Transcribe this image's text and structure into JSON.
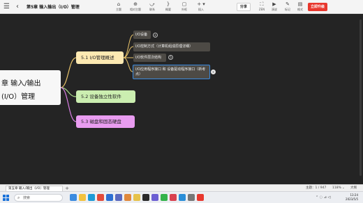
{
  "header": {
    "title": "第5章 输入输出（I/O）管理",
    "tools": [
      {
        "icon": "home-icon",
        "glyph": "⌂",
        "label": "主题"
      },
      {
        "icon": "insert-topic-icon",
        "glyph": "⊕",
        "label": "相对主题"
      },
      {
        "icon": "link-icon",
        "glyph": "⤻",
        "label": "联系"
      },
      {
        "icon": "summary-icon",
        "glyph": "}",
        "label": "概要"
      },
      {
        "icon": "frame-icon",
        "glyph": "▢",
        "label": "外框"
      },
      {
        "icon": "insert-icon",
        "glyph": "+ ▾",
        "label": "插入"
      }
    ],
    "share_label": "分享",
    "right_tools": [
      {
        "icon": "zen-mode-icon",
        "glyph": "⛶",
        "label": "ZEN"
      },
      {
        "icon": "play-icon",
        "glyph": "▶",
        "label": "演说"
      },
      {
        "icon": "marker-icon",
        "glyph": "✎",
        "label": "标记"
      },
      {
        "icon": "format-icon",
        "glyph": "▤",
        "label": "格式"
      }
    ],
    "upgrade_label": "立即升级"
  },
  "mindmap": {
    "root": {
      "line1": "章 输入/输出",
      "line2": "(I/O）管理"
    },
    "topics": [
      {
        "label": "5.1 I/O管理概述",
        "color": "#fde9b2"
      },
      {
        "label": "5.2 设备独立性软件",
        "color": "#cbeeb0"
      },
      {
        "label": "5.3 磁盘和固态硬盘",
        "color": "#e99cf0"
      }
    ],
    "subtopics": [
      {
        "label": "I/O设备",
        "toggle": "+"
      },
      {
        "label": "I/O控制方式（计算机组成原理详细）"
      },
      {
        "label": "I/O软件层次结构",
        "toggle": "5"
      },
      {
        "label": "I/O应用程序接口 和 设备驱动程序接口（新考点）",
        "toggle": "+"
      }
    ]
  },
  "sheet": {
    "tab_label": "第五章 输入/输出（I/O）管理",
    "add_label": "+",
    "topic_count": "主题：1 / 947",
    "zoom": "118%",
    "zoom_arrow": "⌄",
    "zoom_extra": "大纲"
  },
  "taskbar": {
    "search_placeholder": "搜索",
    "tray_text": "⌃  ◌  ⊿  ◁",
    "time": "13:24",
    "date": "2023/5/5",
    "apps": [
      {
        "name": "widgets-app",
        "color": "#3b8be0"
      },
      {
        "name": "file-explorer-app",
        "color": "#f3c23d"
      },
      {
        "name": "edge-app",
        "color": "#1e9ad6"
      },
      {
        "name": "chrome-app",
        "color": "#e24a3a"
      },
      {
        "name": "store-app",
        "color": "#2d6fd2"
      },
      {
        "name": "mail-app",
        "color": "#5b6abf"
      },
      {
        "name": "photos-app",
        "color": "#e0883b"
      },
      {
        "name": "notes-app",
        "color": "#e6c24a"
      },
      {
        "name": "terminal-app",
        "color": "#2a2a2a"
      },
      {
        "name": "teams-app",
        "color": "#6c5fd3"
      },
      {
        "name": "wechat-app",
        "color": "#34b34a"
      },
      {
        "name": "music-app",
        "color": "#d9414f"
      },
      {
        "name": "vscode-app",
        "color": "#2a8ed8"
      },
      {
        "name": "settings-app",
        "color": "#777777"
      },
      {
        "name": "xmind-app",
        "color": "#e8382e"
      }
    ]
  }
}
